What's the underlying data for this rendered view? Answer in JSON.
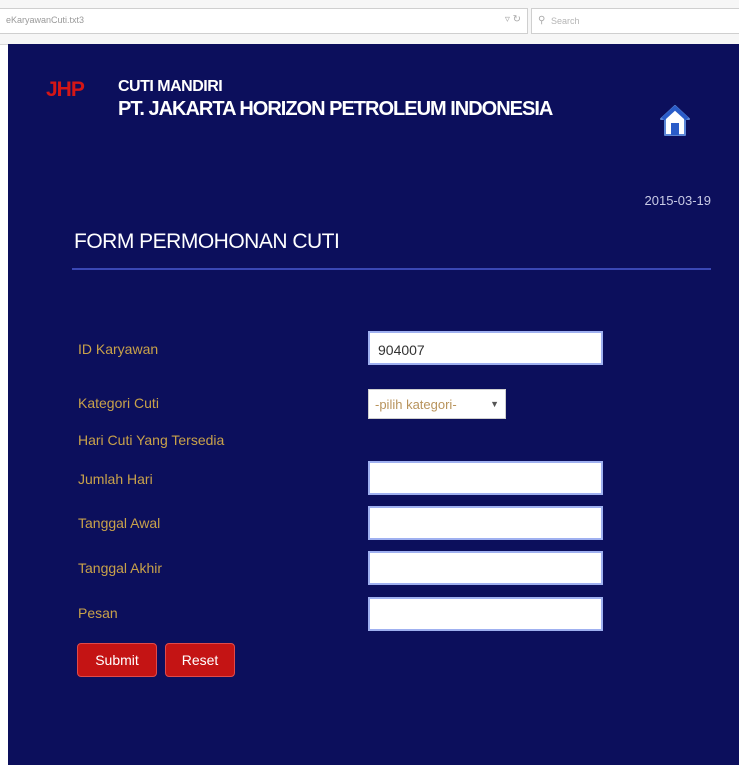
{
  "browser": {
    "url": "eKaryawanCuti.txt3",
    "search_placeholder": "Search"
  },
  "header": {
    "logo": "JHP",
    "title": "CUTI MANDIRI",
    "company": "PT. JAKARTA HORIZON PETROLEUM INDONESIA",
    "home_icon": "home-icon"
  },
  "date": "2015-03-19",
  "form": {
    "title": "FORM PERMOHONAN CUTI",
    "id_label": "ID Karyawan",
    "id_value": "904007",
    "category_label": "Kategori Cuti",
    "category_selected": "-pilih kategori-",
    "available_label": "Hari Cuti Yang Tersedia",
    "days_label": "Jumlah Hari",
    "days_value": "",
    "start_label": "Tanggal Awal",
    "start_value": "",
    "end_label": "Tanggal Akhir",
    "end_value": "",
    "message_label": "Pesan",
    "message_value": "",
    "submit_label": "Submit",
    "reset_label": "Reset"
  },
  "colors": {
    "background": "#0c0f5c",
    "label": "#c9a24a",
    "logo": "#d41616",
    "button": "#c41414"
  }
}
